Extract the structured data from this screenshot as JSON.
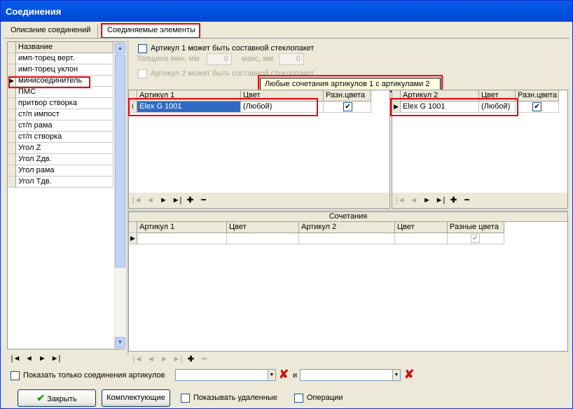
{
  "window": {
    "title": "Соединения",
    "close": "×"
  },
  "tabs": [
    {
      "label": "Описание соединений"
    },
    {
      "label": "Соединяемые элементы"
    }
  ],
  "left_list": {
    "header": "Название",
    "items": [
      "имп-торец верт.",
      "имп-торец уклон",
      "минисоединитель",
      "ПМС",
      "притвор створка",
      "ст/п импост",
      "ст/п рама",
      "ст/п створка",
      "Угол Z",
      "Угол Zдв.",
      "Угол рама",
      "Угол Тдв."
    ],
    "selected_index": 2,
    "nav": [
      "|◄",
      "◄",
      "►",
      "►|"
    ]
  },
  "options": {
    "article1_composite": "Артикул 1 может быть составной стеклопакет",
    "thickness_min_label": "Толщина мин, мм",
    "thickness_min_value": "0",
    "thickness_max_label": "макс, мм",
    "thickness_max_value": "0",
    "article2_composite": "Артикул 2 может быть составной стеклопакет"
  },
  "tooltip": "Любые сочетания артикулов 1 с артикулами 2",
  "grid1": {
    "headers": [
      "Артикул 1",
      "Цвет",
      "Разн.цвета"
    ],
    "row": {
      "article": "Elex G 1001",
      "color": "(Любой)",
      "diff": true
    }
  },
  "grid2": {
    "headers": [
      "Артикул 2",
      "Цвет",
      "Разн.цвета"
    ],
    "row": {
      "article": "Elex G 1001",
      "color": "(Любой)",
      "diff": true
    }
  },
  "grid_nav": [
    "|◄",
    "◄",
    "►",
    "►|",
    "✚",
    "━"
  ],
  "combinations": {
    "title": "Сочетания",
    "headers": [
      "Артикул 1",
      "Цвет",
      "Артикул 2",
      "Цвет",
      "Разные цвета"
    ]
  },
  "filter": {
    "show_only_label": "Показать только соединения артикулов",
    "and_label": "и"
  },
  "footer": {
    "close_label": "Закрыть",
    "components_label": "Комплектующие",
    "show_deleted_label": "Показывать удаленные",
    "operations_label": "Операции"
  },
  "colors": {
    "title_bar": "#0055E3",
    "highlight": "#E8000B",
    "selection": "#316AC5"
  }
}
